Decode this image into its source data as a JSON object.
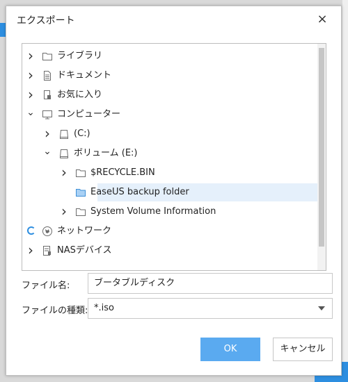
{
  "dialog": {
    "title": "エクスポート",
    "close_glyph": "×"
  },
  "tree": {
    "items": [
      {
        "label": "ライブラリ",
        "icon": "folder-icon",
        "expander": "chevron-right"
      },
      {
        "label": "ドキュメント",
        "icon": "document-icon",
        "expander": "chevron-right"
      },
      {
        "label": "お気に入り",
        "icon": "favorites-icon",
        "expander": "chevron-right"
      },
      {
        "label": "コンピューター",
        "icon": "computer-icon",
        "expander": "chevron-down"
      },
      {
        "label": "(C:)",
        "icon": "drive-icon",
        "expander": "chevron-right"
      },
      {
        "label": "ボリューム (E:)",
        "icon": "drive-icon",
        "expander": "chevron-down"
      },
      {
        "label": "$RECYCLE.BIN",
        "icon": "folder-icon",
        "expander": "chevron-right"
      },
      {
        "label": "EaseUS backup folder",
        "icon": "folder-icon",
        "expander": "none",
        "selected": true
      },
      {
        "label": "System Volume Information",
        "icon": "folder-icon",
        "expander": "chevron-right"
      },
      {
        "label": "ネットワーク",
        "icon": "network-icon",
        "expander": "loading-spinner"
      },
      {
        "label": "NASデバイス",
        "icon": "nas-icon",
        "expander": "chevron-right"
      }
    ]
  },
  "filename": {
    "label": "ファイル名:",
    "value": "ブータブルディスク"
  },
  "filetype": {
    "label": "ファイルの種類:",
    "value": "*.iso"
  },
  "buttons": {
    "ok": "OK",
    "cancel": "キャンセル"
  },
  "colors": {
    "accent": "#5aaaf0",
    "selection": "#e5f0fb"
  }
}
